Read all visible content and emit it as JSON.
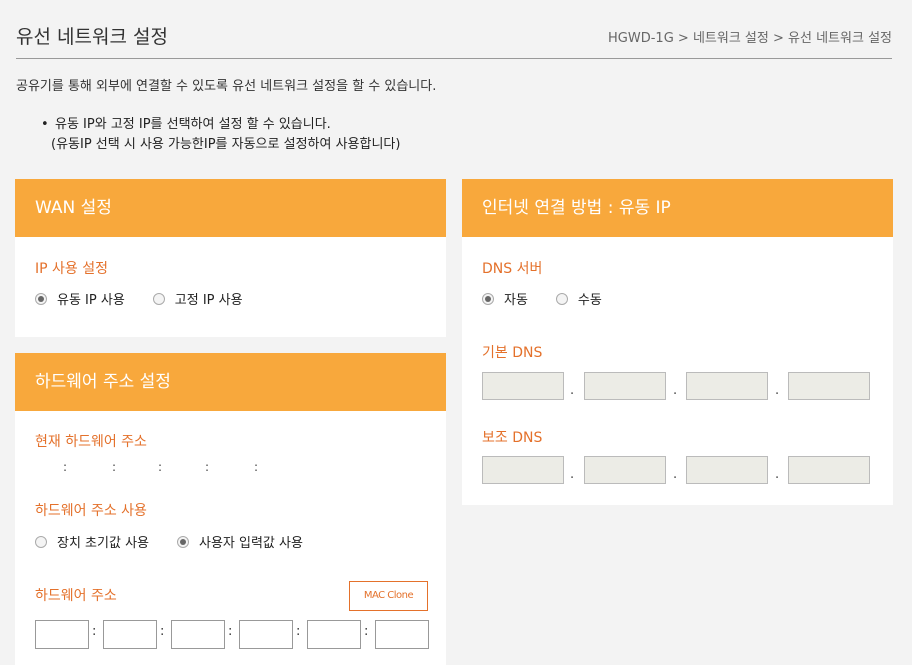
{
  "header": {
    "title": "유선 네트워크 설정",
    "breadcrumb": [
      "HGWD-1G",
      "네트워크 설정",
      "유선 네트워크 설정"
    ],
    "separator": ">"
  },
  "intro": "공유기를 통해 외부에 연결할 수 있도록 유선 네트워크 설정을 할 수 있습니다.",
  "notes": {
    "bullet": "•",
    "line1": "유동 IP와 고정 IP를 선택하여 설정 할 수 있습니다.",
    "line2": "(유동IP 선택 시 사용 가능한IP를 자동으로 설정하여 사용합니다)"
  },
  "wan": {
    "title": "WAN 설정",
    "ip_label": "IP 사용 설정",
    "options": [
      "유동 IP 사용",
      "고정 IP 사용"
    ],
    "selected": 0
  },
  "hw": {
    "title": "하드웨어 주소 설정",
    "current_label": "현재 하드웨어 주소",
    "current_separators": [
      ":",
      ":",
      ":",
      ":",
      ":"
    ],
    "use_label": "하드웨어 주소 사용",
    "options": [
      "장치 초기값 사용",
      "사용자 입력값 사용"
    ],
    "selected": 1,
    "addr_label": "하드웨어 주소",
    "clone_button": "MAC Clone",
    "addr_separators": [
      ":",
      ":",
      ":",
      ":",
      ":"
    ]
  },
  "internet": {
    "title": "인터넷 연결 방법 : 유동 IP",
    "dns_label": "DNS 서버",
    "options": [
      "자동",
      "수동"
    ],
    "selected": 0,
    "primary_label": "기본 DNS",
    "secondary_label": "보조 DNS",
    "dot": "."
  },
  "colors": {
    "accent": "#f8a83c",
    "label": "#e4712b"
  }
}
